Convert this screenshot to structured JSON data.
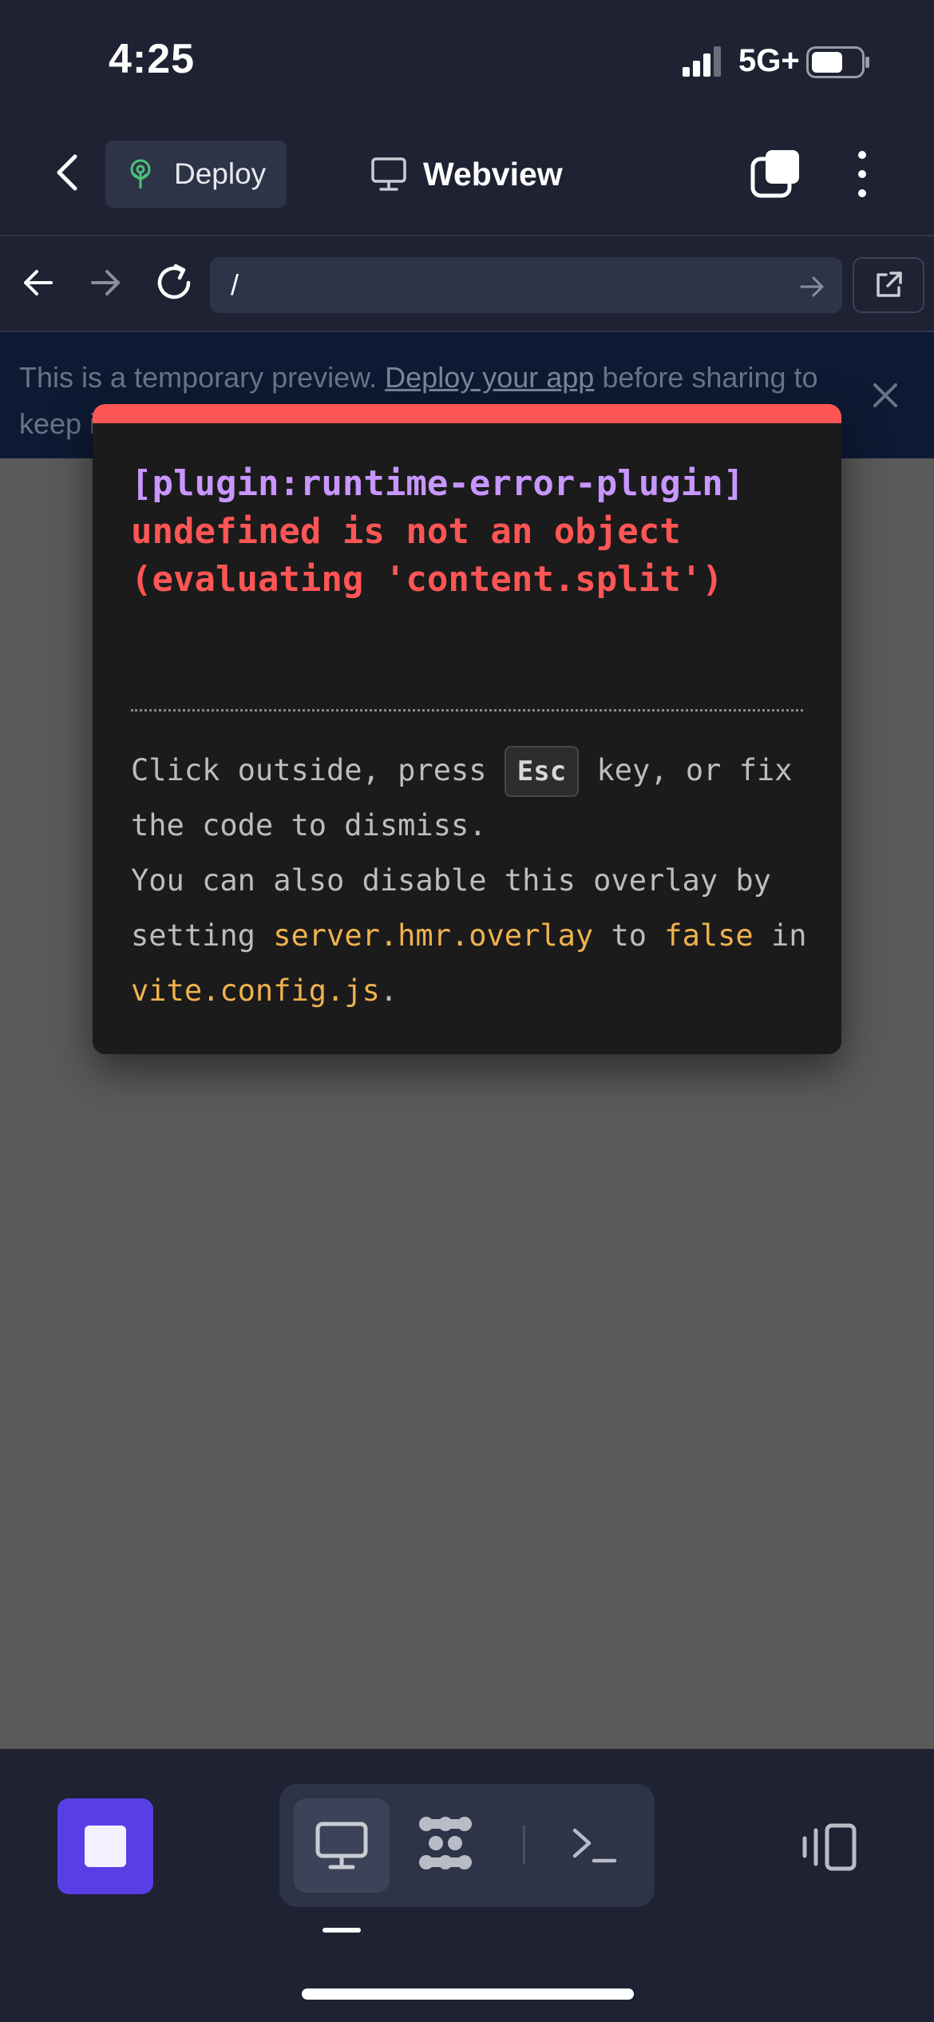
{
  "status_bar": {
    "time": "4:25",
    "network": "5G+",
    "signal_bars": 3,
    "battery_level": 0.55
  },
  "top_nav": {
    "back_icon": "chevron-left-icon",
    "deploy_label": "Deploy",
    "deploy_icon": "deploy-tree-icon",
    "title": "Webview",
    "title_icon": "monitor-icon",
    "tabs_icon": "tabs-icon",
    "more_icon": "more-vertical-icon"
  },
  "url_bar": {
    "value": "/",
    "back_icon": "arrow-left-icon",
    "forward_icon": "arrow-right-icon",
    "reload_icon": "reload-icon",
    "go_icon": "arrow-right-icon",
    "open_external_icon": "external-link-icon"
  },
  "banner": {
    "text_before": "This is a temporary preview. ",
    "link": "Deploy your app",
    "text_after": " before sharing to keep it running.",
    "close_icon": "close-icon"
  },
  "error_overlay": {
    "plugin": "[plugin:runtime-error-plugin]",
    "message": "undefined is not an object (evaluating 'content.split')",
    "tip": {
      "part1": "Click outside, press ",
      "key": "Esc",
      "part2": " key, or fix the code to dismiss.",
      "part3": "You can also disable this overlay by setting ",
      "code1": "server.hmr.overlay",
      "part4": " to ",
      "code2": "false",
      "part5": " in ",
      "code3": "vite.config.js",
      "part6": "."
    },
    "colors": {
      "accent_bar": "#ff5555",
      "plugin": "#c796ff",
      "message": "#ff5555",
      "code": "#f0b24e"
    }
  },
  "bottom_bar": {
    "stop_icon": "stop-icon",
    "tools": [
      "monitor-icon",
      "agent-icon",
      "terminal-icon"
    ],
    "active_tool": "monitor-icon",
    "panels_icon": "panels-icon",
    "colors": {
      "stop_button": "#5a3ee5"
    }
  }
}
